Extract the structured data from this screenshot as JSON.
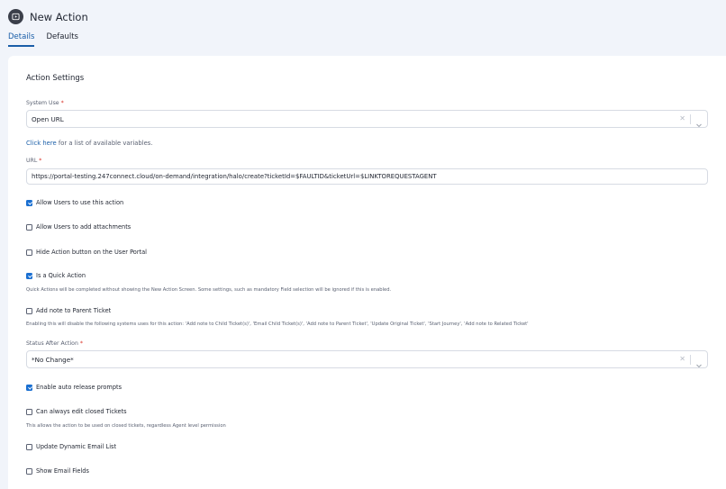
{
  "header": {
    "title": "New Action",
    "tabs": [
      {
        "label": "Details",
        "active": true
      },
      {
        "label": "Defaults",
        "active": false
      }
    ]
  },
  "form": {
    "section_title": "Action Settings",
    "system_use": {
      "label": "System Use",
      "required_mark": "*",
      "value": "Open URL"
    },
    "variables_help": {
      "link_text": "Click here",
      "rest_text": " for a list of available variables."
    },
    "url": {
      "label": "URL",
      "required_mark": "*",
      "value": "https://portal-testing.247connect.cloud/on-demand/integration/halo/create?ticketId=$FAULTID&ticketUrl=$LINKTOREQUESTAGENT"
    },
    "checkboxes": {
      "allow_users_use": {
        "label": "Allow Users to use this action",
        "checked": true
      },
      "allow_users_attach": {
        "label": "Allow Users to add attachments",
        "checked": false
      },
      "hide_action_button": {
        "label": "Hide Action button on the User Portal",
        "checked": false
      },
      "quick_action": {
        "label": "Is a Quick Action",
        "checked": true
      },
      "add_note_parent": {
        "label": "Add note to Parent Ticket",
        "checked": false
      },
      "auto_release": {
        "label": "Enable auto release prompts",
        "checked": true
      },
      "edit_closed": {
        "label": "Can always edit closed Tickets",
        "checked": false
      },
      "update_dynamic_email": {
        "label": "Update Dynamic Email List",
        "checked": false
      },
      "show_email_fields": {
        "label": "Show Email Fields",
        "checked": false
      }
    },
    "quick_action_note": "Quick Actions will be completed without showing the New Action Screen. Some settings, such as mandatory Field selection will be ignored if this is enabled.",
    "add_note_parent_note": "Enabling this will disable the following systems uses for this action: 'Add note to Child Ticket(s)', 'Email Child Ticket(s)', 'Add note to Parent Ticket', 'Update Original Ticket', 'Start Journey', 'Add note to Related Ticket'",
    "status_after_action": {
      "label": "Status After Action",
      "required_mark": "*",
      "value": "*No Change*"
    },
    "edit_closed_note": "This allows the action to be used on closed tickets, regardless Agent level permission"
  },
  "icons": {
    "title_icon": "play-circle-icon",
    "clear": "close-icon",
    "dropdown": "chevron-down-icon",
    "checkbox_checked": "checkmark-icon"
  },
  "colors": {
    "accent": "#1a5ea8",
    "checkbox": "#1a6fd1",
    "required": "#d93025",
    "header_bg": "#f1f4fa"
  }
}
